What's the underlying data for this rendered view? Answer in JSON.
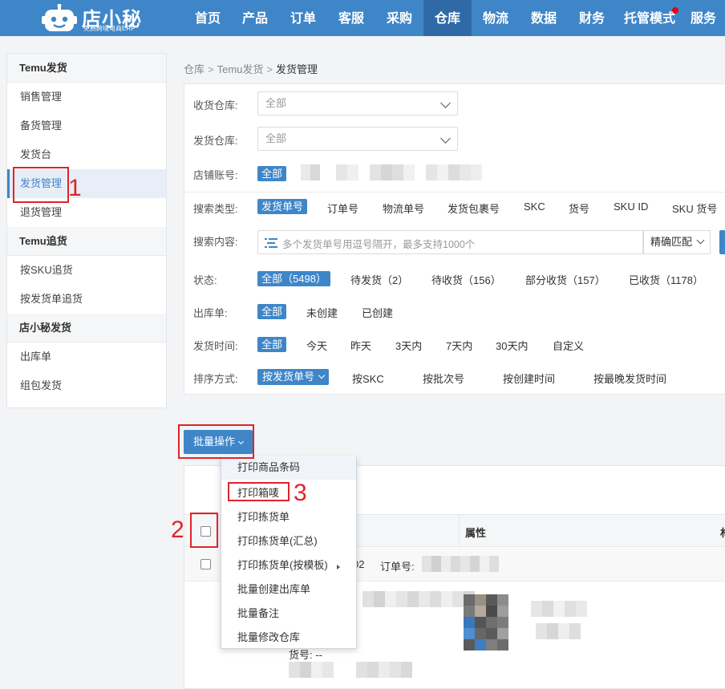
{
  "colors": {
    "primary": "#3f86c9",
    "nav_active": "#2f6aa7",
    "annotation": "#e0232b",
    "notify_dot": "#e0001b"
  },
  "logo": {
    "title": "店小秘",
    "subtitle": "免费跨境电商ERP",
    "icon": "robot-icon"
  },
  "nav": {
    "items": [
      {
        "label": "首页"
      },
      {
        "label": "产品"
      },
      {
        "label": "订单"
      },
      {
        "label": "客服"
      },
      {
        "label": "采购"
      },
      {
        "label": "仓库",
        "active": true
      },
      {
        "label": "物流"
      },
      {
        "label": "数据"
      },
      {
        "label": "财务"
      },
      {
        "label": "托管模式",
        "dot": true
      },
      {
        "label": "服务"
      }
    ]
  },
  "sidebar": {
    "groups": [
      {
        "title": "Temu发货",
        "items": [
          "销售管理",
          "备货管理",
          "发货台",
          "发货管理",
          "退货管理"
        ]
      },
      {
        "title": "Temu追货",
        "items": [
          "按SKU追货",
          "按发货单追货"
        ]
      },
      {
        "title": "店小秘发货",
        "items": [
          "出库单",
          "组包发货"
        ]
      }
    ],
    "active_item": "发货管理"
  },
  "breadcrumb": {
    "level1": "仓库",
    "level2": "Temu发货",
    "current": "发货管理",
    "separator": ">"
  },
  "filters": {
    "receive_wh": {
      "label": "收货仓库:",
      "value": "全部"
    },
    "ship_wh": {
      "label": "发货仓库:",
      "value": "全部"
    },
    "shop": {
      "label": "店铺账号:",
      "selected": "全部"
    },
    "search_type": {
      "label": "搜索类型:",
      "selected": "发货单号",
      "options": [
        "订单号",
        "物流单号",
        "发货包裹号",
        "SKC",
        "货号",
        "SKU ID",
        "SKU 货号"
      ]
    },
    "search": {
      "label": "搜索内容:",
      "placeholder": "多个发货单号用逗号隔开，最多支持1000个",
      "match": "精确匹配",
      "icon": "list-filter-icon"
    },
    "status": {
      "label": "状态:",
      "selected": "全部（5498）",
      "options": [
        "待发货（2）",
        "待收货（156）",
        "部分收货（157）",
        "已收货（1178）"
      ]
    },
    "outbound": {
      "label": "出库单:",
      "selected": "全部",
      "options": [
        "未创建",
        "已创建"
      ]
    },
    "ship_time": {
      "label": "发货时间:",
      "selected": "全部",
      "options": [
        "今天",
        "昨天",
        "3天内",
        "7天内",
        "30天内",
        "自定义"
      ]
    },
    "sort": {
      "label": "排序方式:",
      "selected": "按发货单号",
      "options": [
        "按SKC",
        "按批次号",
        "按创建时间",
        "按最晚发货时间"
      ]
    }
  },
  "batch": {
    "label": "批量操作"
  },
  "menu": {
    "items": [
      {
        "label": "打印商品条码"
      },
      {
        "label": "打印箱唛"
      },
      {
        "label": "打印拣货单"
      },
      {
        "label": "打印拣货单(汇总)"
      },
      {
        "label": "打印拣货单(按模板)",
        "submenu": true
      },
      {
        "label": "批量创建出库单"
      },
      {
        "label": "批量备注"
      },
      {
        "label": "批量修改仓库"
      }
    ]
  },
  "table": {
    "head_attr": "属性",
    "head_right": "材",
    "row_suffix": "02",
    "order_label": "订单号:",
    "sku_label": "货号: --"
  },
  "annotations": {
    "n1": "1",
    "n2": "2",
    "n3": "3"
  }
}
